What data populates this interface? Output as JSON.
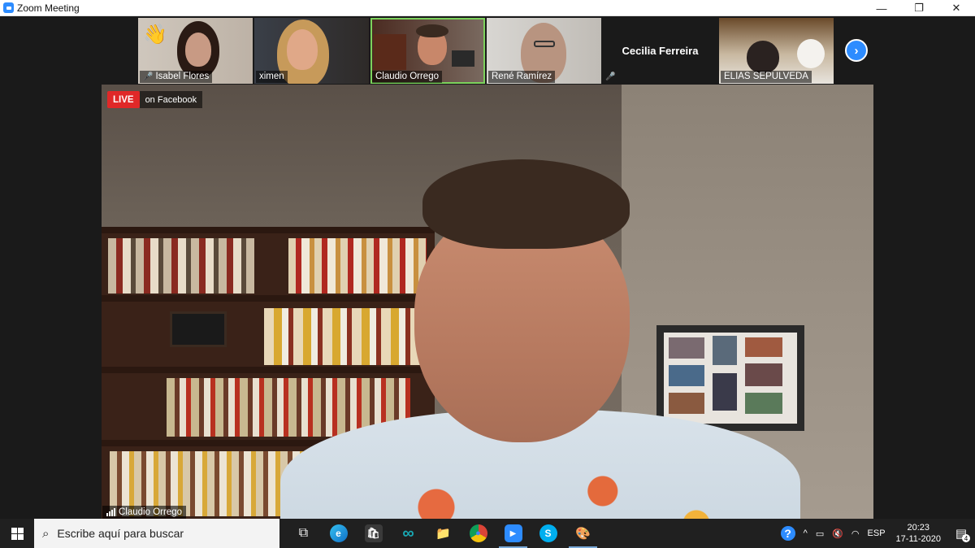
{
  "window": {
    "title": "Zoom Meeting",
    "minimize": "—",
    "restore": "❐",
    "close": "✕"
  },
  "thumbnails": [
    {
      "name": "Isabel Flores",
      "muted": true,
      "reaction": "👋"
    },
    {
      "name": "ximen",
      "muted": false
    },
    {
      "name": "Claudio Orrego",
      "muted": false,
      "active": true
    },
    {
      "name": "René Ramírez",
      "muted": false
    },
    {
      "name": "Cecilia Ferreira",
      "muted": true,
      "video_off": true
    },
    {
      "name": "ELIAS SEPULVEDA",
      "muted": false
    }
  ],
  "next_page_icon": "›",
  "main_video": {
    "live_label": "LIVE",
    "live_on": "on Facebook",
    "speaker_name": "Claudio Orrego"
  },
  "taskbar": {
    "search_placeholder": "Escribe aquí para buscar",
    "apps": [
      {
        "name": "task-view",
        "glyph": "⧉"
      },
      {
        "name": "edge",
        "glyph": "e"
      },
      {
        "name": "store",
        "glyph": "🛍"
      },
      {
        "name": "arduino",
        "glyph": "∞"
      },
      {
        "name": "file-explorer",
        "glyph": "📁"
      },
      {
        "name": "chrome",
        "glyph": "●"
      },
      {
        "name": "zoom",
        "glyph": "▶"
      },
      {
        "name": "skype",
        "glyph": "S"
      },
      {
        "name": "paint",
        "glyph": "🎨"
      }
    ],
    "tray": {
      "language": "ESP",
      "time": "20:23",
      "date": "17-11-2020",
      "notifications": "4"
    }
  },
  "colors": {
    "zoom_blue": "#2d8cff",
    "live_red": "#e02828",
    "active_speaker": "#7cd25c",
    "taskbar": "#202020"
  }
}
